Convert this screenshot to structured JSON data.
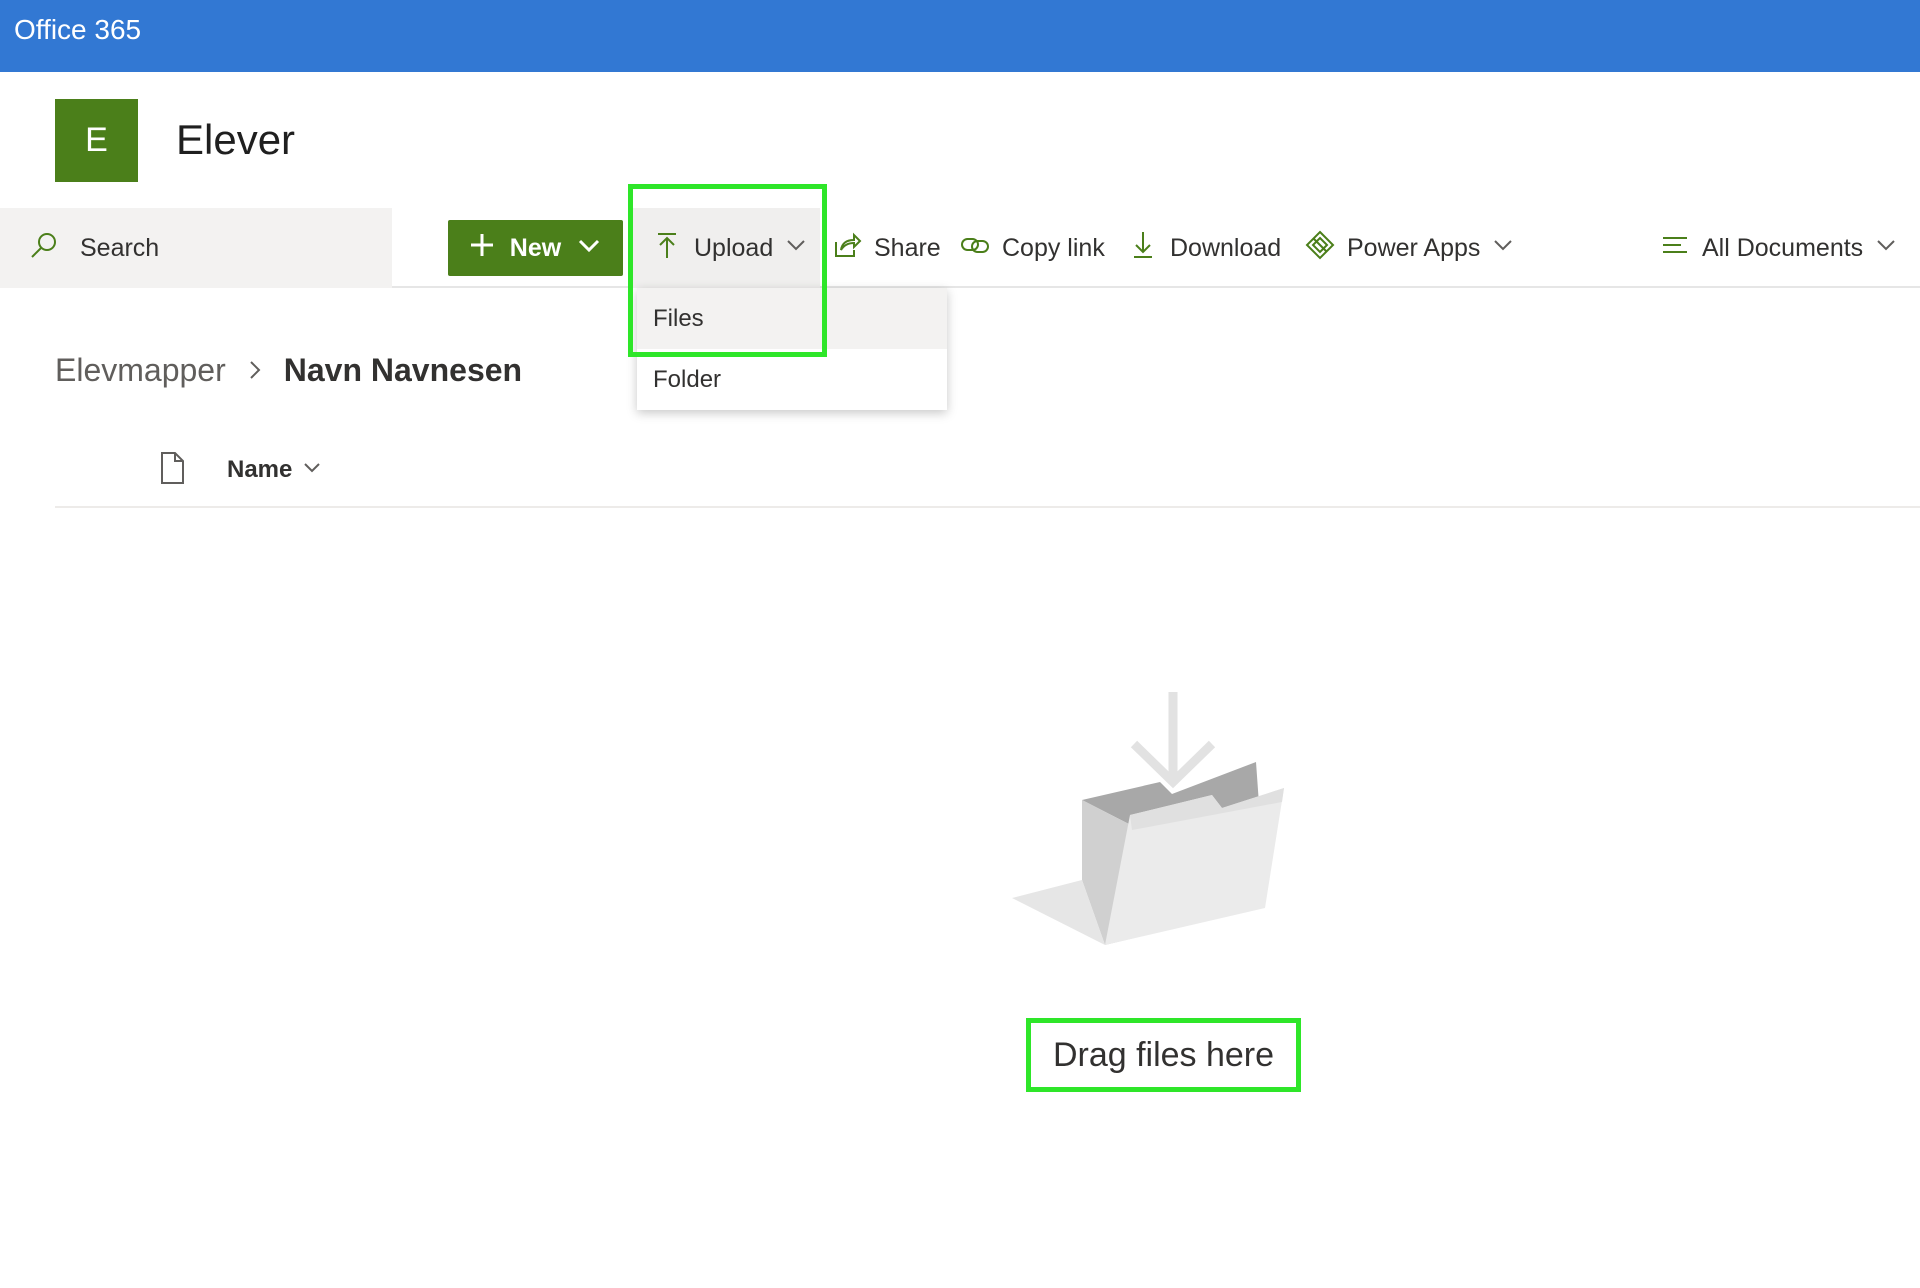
{
  "topbar": {
    "app_title": "Office 365"
  },
  "site": {
    "logo_letter": "E",
    "name": "Elever",
    "logo_color": "#4b7f1a"
  },
  "search": {
    "label": "Search"
  },
  "commands": {
    "new_label": "New",
    "upload_label": "Upload",
    "share_label": "Share",
    "copy_link_label": "Copy link",
    "download_label": "Download",
    "power_apps_label": "Power Apps",
    "view_label": "All Documents"
  },
  "upload_menu": {
    "items": [
      "Files",
      "Folder"
    ]
  },
  "breadcrumb": {
    "parent": "Elevmapper",
    "current": "Navn Navnesen"
  },
  "list": {
    "name_column": "Name"
  },
  "empty_state": {
    "text": "Drag files here"
  },
  "colors": {
    "brand_blue": "#3278d3",
    "accent_green": "#4b7f1a",
    "highlight": "#2ee629"
  }
}
